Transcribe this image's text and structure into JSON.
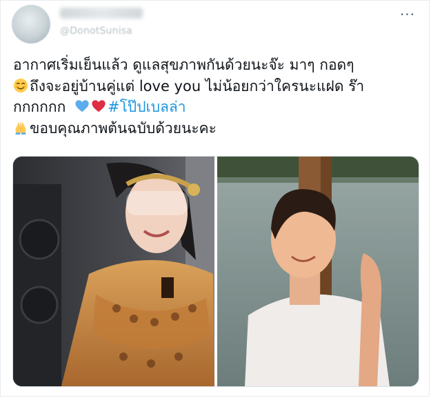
{
  "tweet": {
    "handle": "@DonotSunisa",
    "more_label": "···",
    "lines": {
      "l1": "อากาศเริ่มเย็นแล้ว ดูแลสุขภาพกันด้วยนะจ๊ะ มาๆ กอดๆ",
      "l2": "ถึงจะอยู่บ้านคู่แต่ love you ไม่น้อยกว่าใครนะแฝด ร๊า",
      "l3_text": "กกกกกก",
      "l3_hashtag": "#โป๊ปเบลล่า",
      "l4": "ขอบคุณภาพต้นฉบับด้วยนะคะ"
    },
    "emojis": [
      "smiling-face-emoji",
      "blue-heart-emoji",
      "red-heart-emoji",
      "folded-hands-emoji"
    ],
    "colors": {
      "hashtag": "#1b95e0",
      "text": "#0f1419",
      "secondary": "#536471"
    }
  },
  "media": {
    "photos": [
      {
        "name": "photo-woman-thai-costume"
      },
      {
        "name": "photo-man-white-tshirt"
      }
    ]
  }
}
